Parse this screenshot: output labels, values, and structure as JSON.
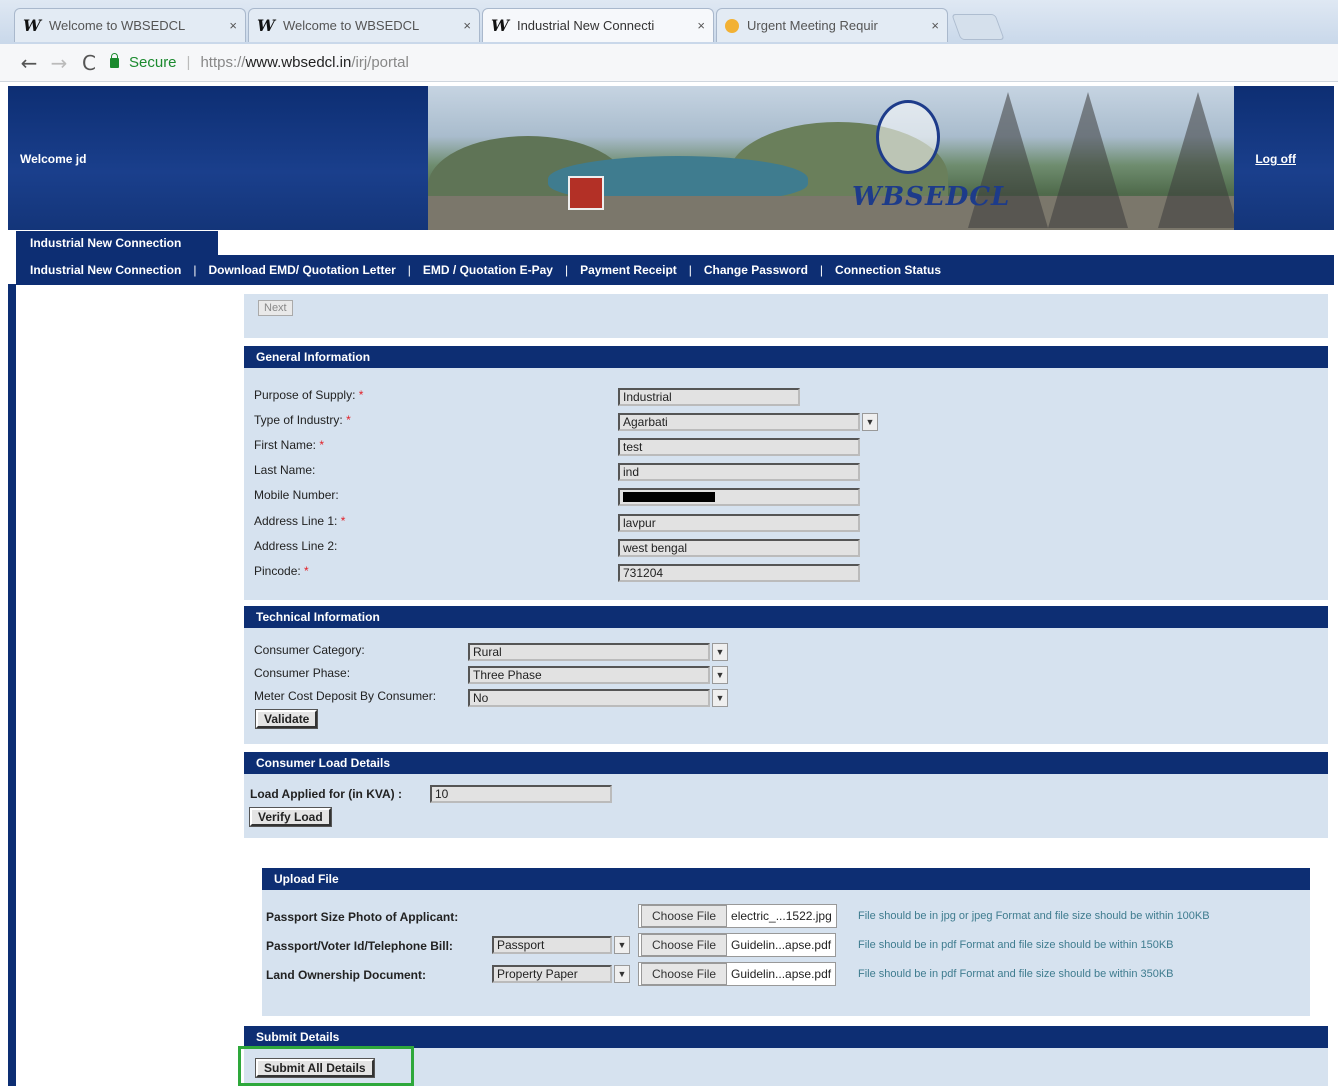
{
  "browser": {
    "tabs": [
      {
        "title": "Welcome to WBSEDCL",
        "icon": "wbsedcl-favicon",
        "active": false
      },
      {
        "title": "Welcome to WBSEDCL",
        "icon": "wbsedcl-favicon",
        "active": false
      },
      {
        "title": "Industrial New Connecti",
        "icon": "wbsedcl-favicon",
        "active": true
      },
      {
        "title": "Urgent Meeting Requir",
        "icon": "clock-favicon",
        "active": false
      }
    ],
    "close_glyph": "×",
    "favicon_glyph": "W",
    "nav": {
      "back": "←",
      "forward": "→",
      "reload": "C"
    },
    "secure_label": "Secure",
    "url_proto": "https://",
    "url_host": "www.wbsedcl.in",
    "url_path": "/irj/portal"
  },
  "header": {
    "welcome": "Welcome jd",
    "logoff": "Log off",
    "brand": "WBSEDCL"
  },
  "nav": {
    "active_tab": "Industrial New Connection",
    "items": [
      "Industrial New Connection",
      "Download EMD/ Quotation Letter",
      "EMD / Quotation E-Pay",
      "Payment Receipt",
      "Change Password",
      "Connection Status"
    ],
    "separator": "|"
  },
  "next_button": "Next",
  "general": {
    "title": "General Information",
    "required_mark": "*",
    "purpose_label": "Purpose of Supply:",
    "purpose_value": "Industrial",
    "industry_label": "Type of Industry:",
    "industry_value": "Agarbati",
    "first_label": "First Name:",
    "first_value": "test",
    "last_label": "Last Name:",
    "last_value": "ind",
    "mobile_label": "Mobile Number:",
    "address1_label": "Address Line 1:",
    "address1_value": "lavpur",
    "address2_label": "Address Line 2:",
    "address2_value": "west bengal",
    "pincode_label": "Pincode:",
    "pincode_value": "731204"
  },
  "technical": {
    "title": "Technical Information",
    "category_label": "Consumer Category:",
    "category_value": "Rural",
    "phase_label": "Consumer Phase:",
    "phase_value": "Three Phase",
    "meter_label": "Meter Cost Deposit By Consumer:",
    "meter_value": "No",
    "validate_button": "Validate"
  },
  "load": {
    "title": "Consumer Load Details",
    "label": "Load Applied for (in KVA) :",
    "value": "10",
    "verify_button": "Verify Load"
  },
  "upload": {
    "title": "Upload File",
    "choose_label": "Choose File",
    "photo_label": "Passport Size Photo of Applicant:",
    "photo_file": "electric_...1522.jpg",
    "photo_note": "File should be in jpg or jpeg Format and file size should be within 100KB",
    "id_label": "Passport/Voter Id/Telephone Bill:",
    "id_select": "Passport",
    "id_file": "Guidelin...apse.pdf",
    "id_note": "File should be in pdf Format and file size should be within 150KB",
    "land_label": "Land Ownership Document:",
    "land_select": "Property Paper",
    "land_file": "Guidelin...apse.pdf",
    "land_note": "File should be in pdf Format and file size should be within 350KB"
  },
  "submit": {
    "title": "Submit Details",
    "button": "Submit All Details"
  },
  "colors": {
    "navy": "#0d2e73",
    "panel": "#d6e2ef",
    "highlight": "#2ea83b",
    "required": "#e21f26"
  }
}
